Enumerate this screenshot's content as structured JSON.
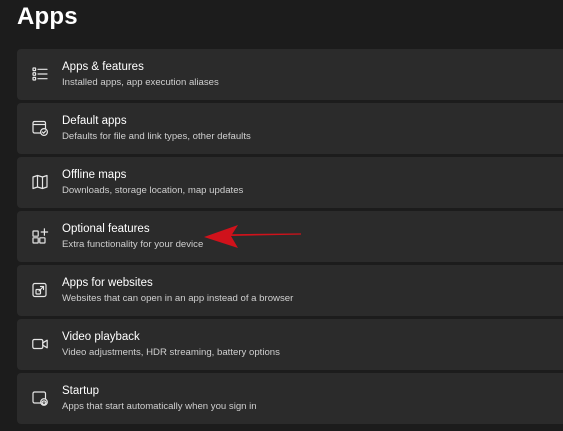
{
  "header": {
    "title": "Apps"
  },
  "items": [
    {
      "title": "Apps & features",
      "subtitle": "Installed apps, app execution aliases",
      "icon": "apps-list-icon"
    },
    {
      "title": "Default apps",
      "subtitle": "Defaults for file and link types, other defaults",
      "icon": "default-apps-icon"
    },
    {
      "title": "Offline maps",
      "subtitle": "Downloads, storage location, map updates",
      "icon": "map-icon"
    },
    {
      "title": "Optional features",
      "subtitle": "Extra functionality for your device",
      "icon": "optional-features-icon"
    },
    {
      "title": "Apps for websites",
      "subtitle": "Websites that can open in an app instead of a browser",
      "icon": "open-in-app-icon"
    },
    {
      "title": "Video playback",
      "subtitle": "Video adjustments, HDR streaming, battery options",
      "icon": "video-camera-icon"
    },
    {
      "title": "Startup",
      "subtitle": "Apps that start automatically when you sign in",
      "icon": "startup-icon"
    }
  ],
  "colors": {
    "background": "#1c1c1c",
    "card": "#2b2b2b",
    "annotation_arrow": "#d0121b"
  }
}
